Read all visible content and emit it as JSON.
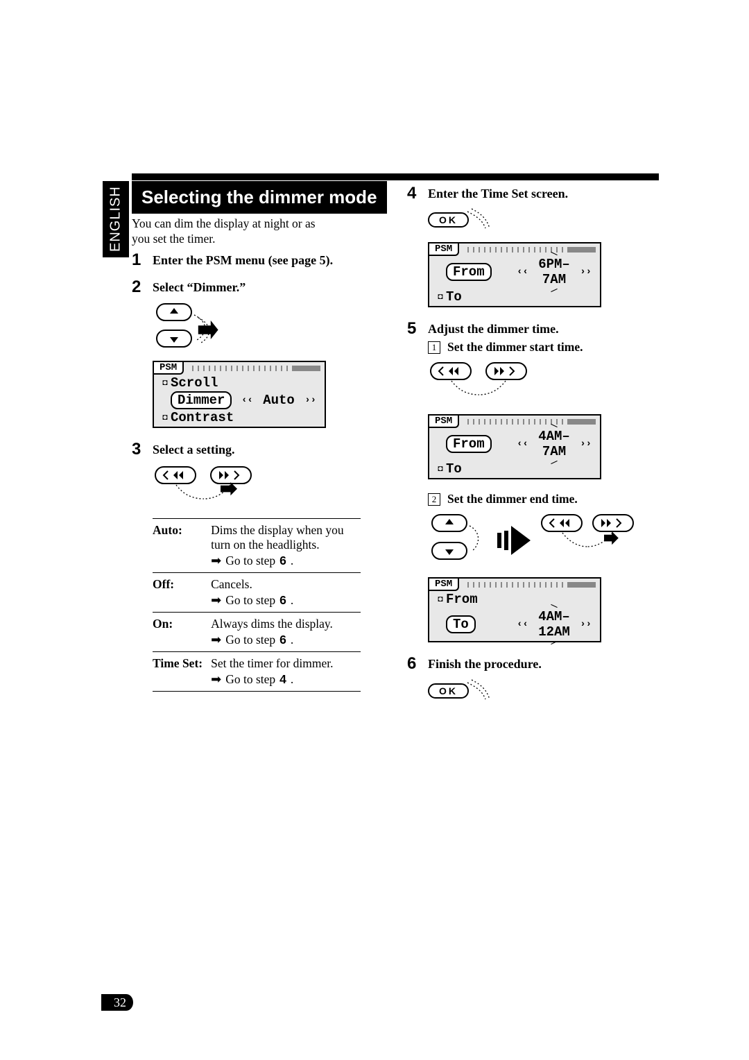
{
  "language_tab": "ENGLISH",
  "title": "Selecting the dimmer mode",
  "intro": "You can dim the display at night or as you set the timer.",
  "page_number": "32",
  "left": {
    "step1": "Enter the PSM menu (see page 5).",
    "step2": "Select “Dimmer.”",
    "psm1": {
      "hdr": "PSM",
      "rowA_icon": "◘",
      "rowA_lab": "Scroll",
      "rowB_lab": "Dimmer",
      "rowB_left": "‹‹",
      "rowB_val": "Auto",
      "rowB_right": "››",
      "rowC_icon": "◘",
      "rowC_lab": "Contrast"
    },
    "step3": "Select a setting.",
    "table": {
      "auto_k": "Auto:",
      "auto_v": "Dims the display when you turn on the headlights.",
      "auto_g": "Go to step",
      "auto_n": "6",
      "off_k": "Off:",
      "off_v": "Cancels.",
      "off_g": "Go to step",
      "off_n": "6",
      "on_k": "On:",
      "on_v": "Always dims the display.",
      "on_g": "Go to step",
      "on_n": "6",
      "ts_k": "Time Set:",
      "ts_v": "Set the timer for dimmer.",
      "ts_g": "Go to step",
      "ts_n": "4"
    }
  },
  "right": {
    "step4": "Enter the Time Set screen.",
    "ok": "OK",
    "psm2": {
      "hdr": "PSM",
      "rowA_lab": "From",
      "rowA_left": "‹‹",
      "rowA_val": "6PM– 7AM",
      "rowA_right": "››",
      "rowB_icon": "◘",
      "rowB_lab": "To"
    },
    "step5": "Adjust the dimmer time.",
    "sub1_n": "1",
    "sub1": "Set the dimmer start time.",
    "psm3": {
      "hdr": "PSM",
      "rowA_lab": "From",
      "rowA_left": "‹‹",
      "rowA_val": "4AM– 7AM",
      "rowA_right": "››",
      "rowB_icon": "◘",
      "rowB_lab": "To"
    },
    "sub2_n": "2",
    "sub2": "Set the dimmer end time.",
    "psm4": {
      "hdr": "PSM",
      "rowA_icon": "◘",
      "rowA_lab": "From",
      "rowB_lab": "To",
      "rowB_left": "‹‹",
      "rowB_val": "4AM–12AM",
      "rowB_right": "››"
    },
    "step6": "Finish the procedure."
  }
}
